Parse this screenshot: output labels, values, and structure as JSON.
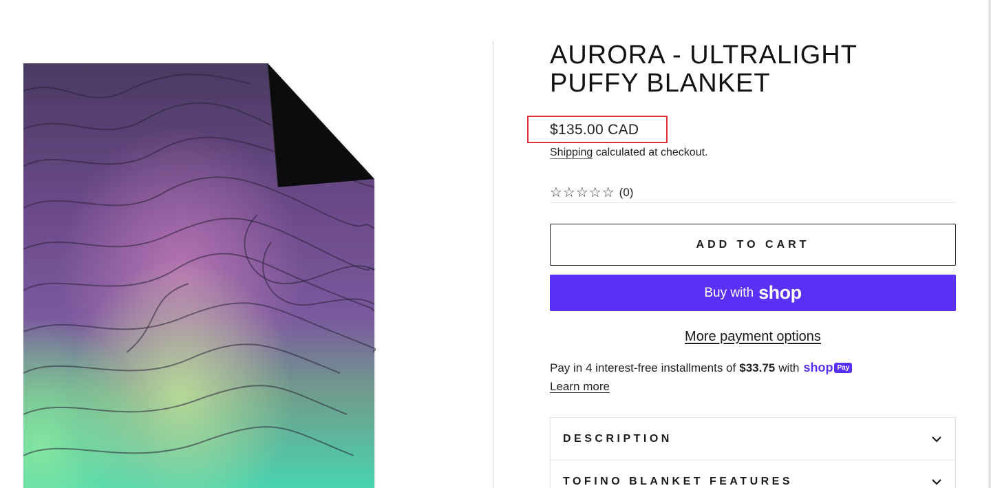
{
  "product": {
    "title_line1": "AURORA - ULTRALIGHT",
    "title_line2": "PUFFY BLANKET",
    "price": "$135.00 CAD",
    "shipping_link": "Shipping",
    "shipping_rest": " calculated at checkout.",
    "stars": "☆☆☆☆☆",
    "rating_count": "(0)"
  },
  "actions": {
    "add_to_cart": "ADD TO CART",
    "buy_with": "Buy with",
    "shop_word": "shop",
    "more_payment_options": "More payment options"
  },
  "installments": {
    "prefix": "Pay in 4 interest-free installments of",
    "amount": "$33.75",
    "suffix": "with",
    "shop_pay_word": "shop",
    "shop_pay_badge": "Pay",
    "learn_more": "Learn more"
  },
  "accordion": [
    {
      "label": "DESCRIPTION"
    },
    {
      "label": "TOFINO BLANKET FEATURES"
    }
  ],
  "colors": {
    "shop_purple": "#5a31f4",
    "highlight_red": "#e0303a"
  }
}
